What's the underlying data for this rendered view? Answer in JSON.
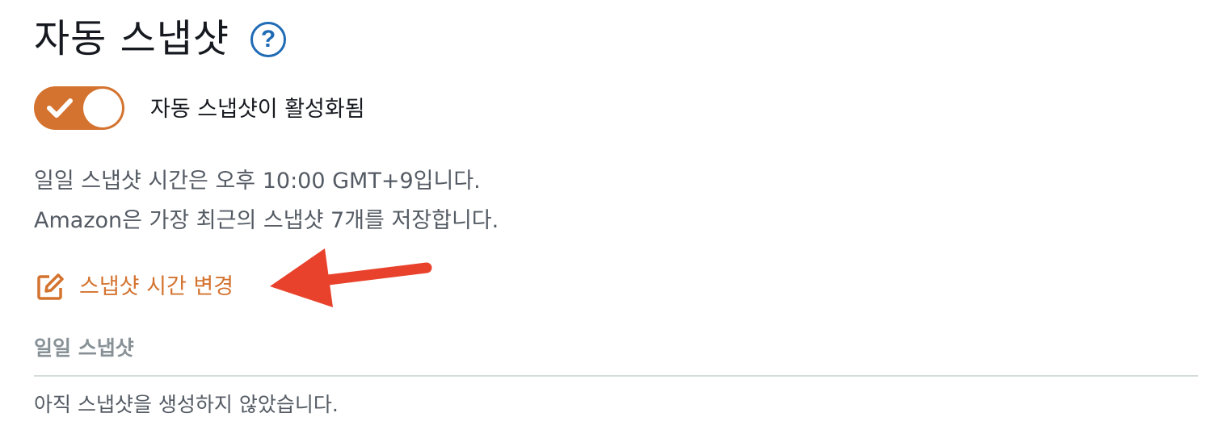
{
  "page": {
    "title": "자동 스냅샷",
    "help_icon_glyph": "?"
  },
  "auto_snapshot": {
    "enabled": true,
    "status_label": "자동 스냅샷이 활성화됨"
  },
  "info": {
    "schedule_text": "일일 스냅샷 시간은 오후 10:00 GMT+9입니다.",
    "retention_text": "Amazon은 가장 최근의 스냅샷 7개를 저장합니다."
  },
  "actions": {
    "change_time_label": "스냅샷 시간 변경",
    "change_time_icon": "edit-icon"
  },
  "daily_snapshots": {
    "header": "일일 스냅샷",
    "empty_message": "아직 스냅샷을 생성하지 않았습니다."
  },
  "colors": {
    "accent_orange": "#d4732f",
    "help_blue": "#1f6bb5",
    "annotation_arrow_red": "#e8422c",
    "muted_text": "#545b64",
    "section_header_gray": "#879196"
  }
}
